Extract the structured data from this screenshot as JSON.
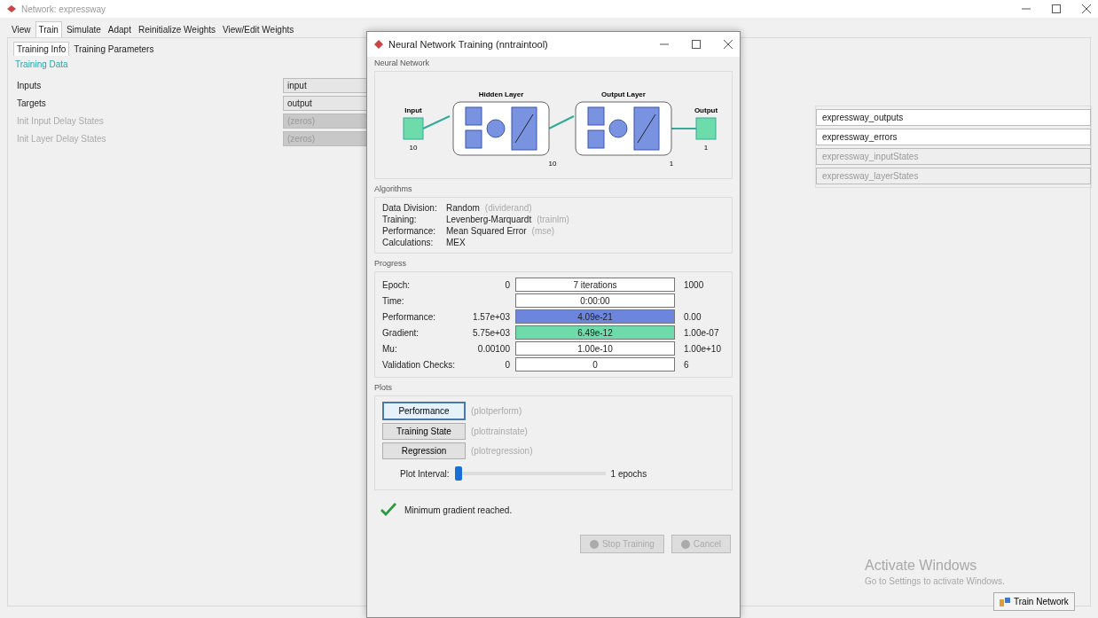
{
  "main_window": {
    "title": "Network: expressway",
    "tabs": [
      {
        "label": "View",
        "selected": false
      },
      {
        "label": "Train",
        "selected": true
      },
      {
        "label": "Simulate",
        "selected": false
      },
      {
        "label": "Adapt",
        "selected": false
      },
      {
        "label": "Reinitialize Weights",
        "selected": false
      },
      {
        "label": "View/Edit Weights",
        "selected": false
      }
    ],
    "subtabs": [
      {
        "label": "Training Info",
        "selected": true
      },
      {
        "label": "Training Parameters",
        "selected": false
      }
    ],
    "section_title": "Training Data",
    "data_rows": [
      {
        "label": "Inputs",
        "value": "input",
        "disabled": false
      },
      {
        "label": "Targets",
        "value": "output",
        "disabled": false
      },
      {
        "label": "Init Input Delay States",
        "value": "(zeros)",
        "disabled": true
      },
      {
        "label": "Init Layer Delay States",
        "value": "(zeros)",
        "disabled": true
      }
    ],
    "result_fields": [
      {
        "value": "expressway_outputs",
        "disabled": false
      },
      {
        "value": "expressway_errors",
        "disabled": false
      },
      {
        "value": "expressway_inputStates",
        "disabled": true
      },
      {
        "value": "expressway_layerStates",
        "disabled": true
      }
    ],
    "activation_notice": {
      "title": "Activate Windows",
      "subtitle": "Go to Settings to activate Windows."
    },
    "train_button": "Train Network"
  },
  "dialog": {
    "title": "Neural Network Training (nntraintool)",
    "network": {
      "title": "Neural Network",
      "input_label": "Input",
      "input_size": "10",
      "hidden_label": "Hidden Layer",
      "hidden_size": "10",
      "output_layer_label": "Output Layer",
      "output_layer_size": "1",
      "output_label": "Output",
      "output_size": "1"
    },
    "algorithms": {
      "title": "Algorithms",
      "rows": [
        {
          "label": "Data Division:",
          "value": "Random",
          "fn": "(dividerand)"
        },
        {
          "label": "Training:",
          "value": "Levenberg-Marquardt",
          "fn": "(trainlm)"
        },
        {
          "label": "Performance:",
          "value": "Mean Squared Error",
          "fn": "(mse)"
        },
        {
          "label": "Calculations:",
          "value": "MEX"
        }
      ]
    },
    "progress": {
      "title": "Progress",
      "rows": [
        {
          "label": "Epoch:",
          "start": "0",
          "current": "7 iterations",
          "end": "1000",
          "level": 0
        },
        {
          "label": "Time:",
          "current": "0:00:00",
          "level": 0
        },
        {
          "label": "Performance:",
          "start": "1.57e+03",
          "current": "4.09e-21",
          "end": "0.00",
          "level": 1,
          "color": "#6c86de"
        },
        {
          "label": "Gradient:",
          "start": "5.75e+03",
          "current": "6.49e-12",
          "end": "1.00e-07",
          "level": 1,
          "color": "#6edcaa"
        },
        {
          "label": "Mu:",
          "start": "0.00100",
          "current": "1.00e-10",
          "end": "1.00e+10",
          "level": 0
        },
        {
          "label": "Validation Checks:",
          "start": "0",
          "current": "0",
          "end": "6",
          "level": 0
        }
      ]
    },
    "plots": {
      "title": "Plots",
      "buttons": [
        {
          "label": "Performance",
          "fn": "(plotperform)",
          "selected": true
        },
        {
          "label": "Training State",
          "fn": "(plottrainstate)",
          "selected": false
        },
        {
          "label": "Regression",
          "fn": "(plotregression)",
          "selected": false
        }
      ],
      "interval_label": "Plot Interval:",
      "interval": {
        "level": 0
      },
      "interval_value": "1 epochs"
    },
    "status": "Minimum gradient reached.",
    "buttons": [
      {
        "label": "Stop Training",
        "disabled": true
      },
      {
        "label": "Cancel",
        "disabled": true
      }
    ]
  }
}
